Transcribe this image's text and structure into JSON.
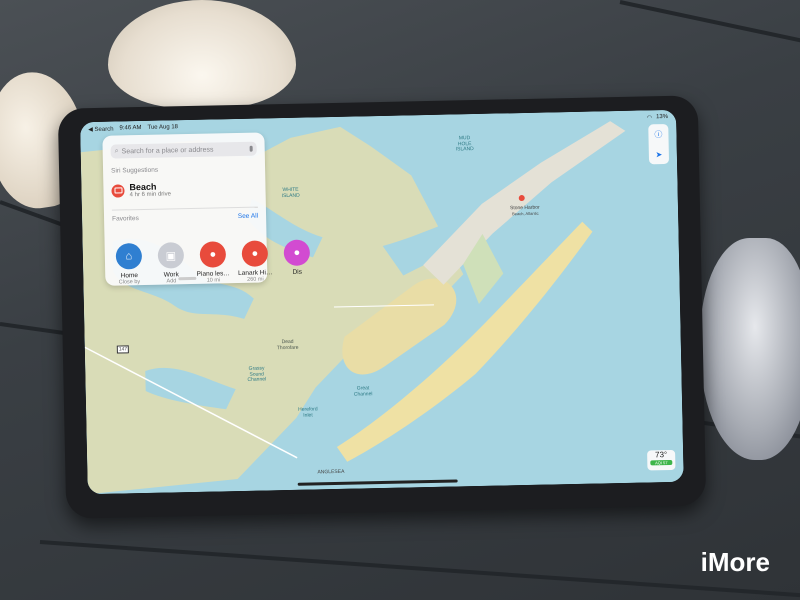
{
  "status_bar": {
    "back_label": "◀ Search",
    "time": "9:46 AM",
    "date": "Tue Aug 18",
    "battery": "13%"
  },
  "search": {
    "placeholder": "Search for a place or address"
  },
  "siri": {
    "header": "Siri Suggestions",
    "title": "Beach",
    "subtitle": "4 hr 6 min drive"
  },
  "favorites": {
    "header": "Favorites",
    "see_all": "See All",
    "items": [
      {
        "name": "Home",
        "sub": "Close by",
        "color": "#2f7fd1",
        "icon": "house-icon"
      },
      {
        "name": "Work",
        "sub": "Add",
        "color": "#c9ccd3",
        "icon": "briefcase-icon"
      },
      {
        "name": "Piano les…",
        "sub": "10 mi",
        "color": "#e84b3c",
        "icon": "pin-icon"
      },
      {
        "name": "Lanark Hi…",
        "sub": "260 mi",
        "color": "#e84b3c",
        "icon": "pin-icon"
      },
      {
        "name": "Dis",
        "sub": "",
        "color": "#d24bd1",
        "icon": "pin-icon"
      }
    ]
  },
  "controls": {
    "info": "ⓘ",
    "locate": "➤"
  },
  "weather": {
    "temp": "73°",
    "aqi": "AQI 57"
  },
  "map_labels": {
    "mud_hole": "MUD\nHOLE\nISLAND",
    "white_island": "WHITE\nISLAND",
    "stone_harbor": "Stone Harbor",
    "stone_harbor_sub": "Beach, Atlantic",
    "grassy_sound": "Grassy\nSound\nChannel",
    "great_channel": "Great\nChannel",
    "hereford": "Hereford\nInlet",
    "dead_thorofare": "Dead\nThorofare",
    "anglesea": "ANGLESEA",
    "route": "147"
  },
  "watermark": "iMore"
}
